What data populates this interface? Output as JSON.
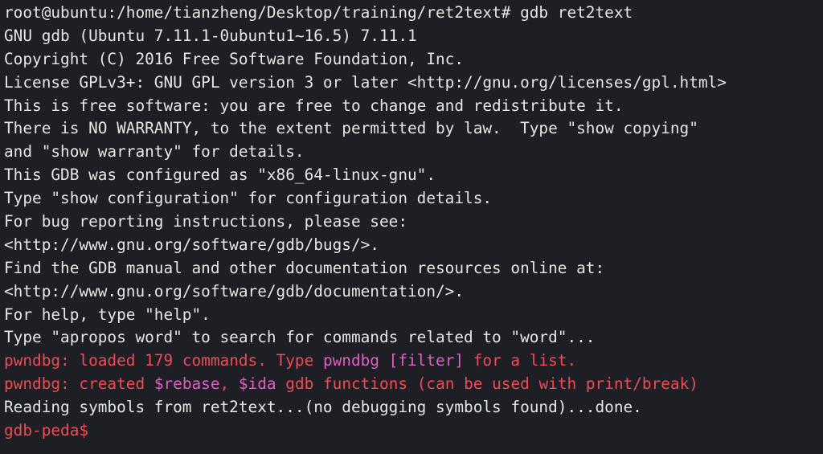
{
  "terminal": {
    "lines": [
      [
        {
          "text": "root@ubuntu:/home/tianzheng/Desktop/training/ret2text# gdb ret2text",
          "color": "white"
        }
      ],
      [
        {
          "text": "GNU gdb (Ubuntu 7.11.1-0ubuntu1~16.5) 7.11.1",
          "color": "white"
        }
      ],
      [
        {
          "text": "Copyright (C) 2016 Free Software Foundation, Inc.",
          "color": "white"
        }
      ],
      [
        {
          "text": "License GPLv3+: GNU GPL version 3 or later <http://gnu.org/licenses/gpl.html>",
          "color": "white"
        }
      ],
      [
        {
          "text": "This is free software: you are free to change and redistribute it.",
          "color": "white"
        }
      ],
      [
        {
          "text": "There is NO WARRANTY, to the extent permitted by law.  Type \"show copying\"",
          "color": "white"
        }
      ],
      [
        {
          "text": "and \"show warranty\" for details.",
          "color": "white"
        }
      ],
      [
        {
          "text": "This GDB was configured as \"x86_64-linux-gnu\".",
          "color": "white"
        }
      ],
      [
        {
          "text": "Type \"show configuration\" for configuration details.",
          "color": "white"
        }
      ],
      [
        {
          "text": "For bug reporting instructions, please see:",
          "color": "white"
        }
      ],
      [
        {
          "text": "<http://www.gnu.org/software/gdb/bugs/>.",
          "color": "white"
        }
      ],
      [
        {
          "text": "Find the GDB manual and other documentation resources online at:",
          "color": "white"
        }
      ],
      [
        {
          "text": "<http://www.gnu.org/software/gdb/documentation/>.",
          "color": "white"
        }
      ],
      [
        {
          "text": "For help, type \"help\".",
          "color": "white"
        }
      ],
      [
        {
          "text": "Type \"apropos word\" to search for commands related to \"word\"...",
          "color": "white"
        }
      ],
      [
        {
          "text": "pwndbg: ",
          "color": "red"
        },
        {
          "text": "loaded 179 commands. Type ",
          "color": "red"
        },
        {
          "text": "pwndbg [filter]",
          "color": "pink"
        },
        {
          "text": " for a list.",
          "color": "red"
        }
      ],
      [
        {
          "text": "pwndbg: ",
          "color": "red"
        },
        {
          "text": "created ",
          "color": "red"
        },
        {
          "text": "$rebase",
          "color": "pink"
        },
        {
          "text": ", ",
          "color": "red"
        },
        {
          "text": "$ida",
          "color": "pink"
        },
        {
          "text": " gdb functions (can be used with print/break)",
          "color": "red"
        }
      ],
      [
        {
          "text": "Reading symbols from ret2text...(no debugging symbols found)...done.",
          "color": "white"
        }
      ],
      [
        {
          "text": "gdb-peda$",
          "color": "red"
        }
      ]
    ]
  },
  "colors": {
    "background": "#1d1f24",
    "white": "#e6e6e6",
    "red": "#ef4b55",
    "pink": "#e15fc2"
  }
}
